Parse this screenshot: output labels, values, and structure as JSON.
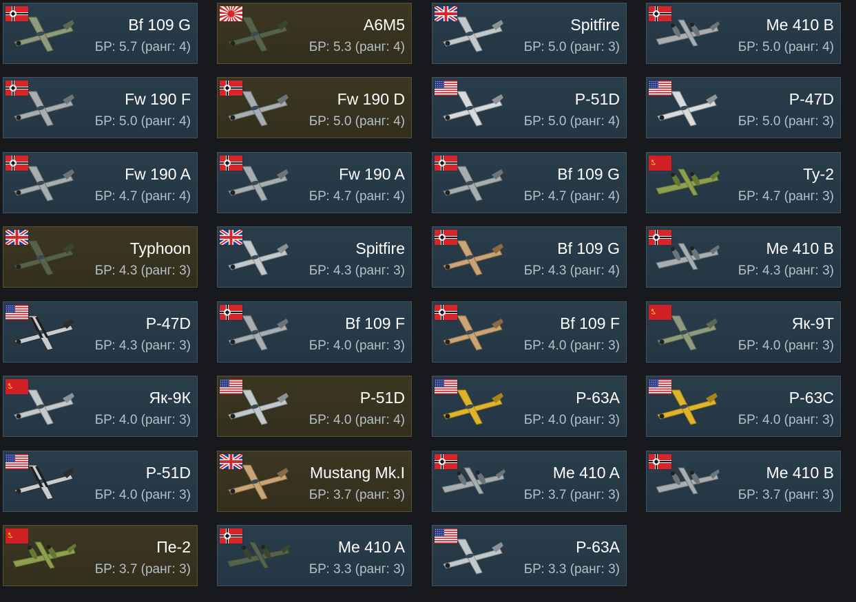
{
  "br_prefix": "БР:",
  "rank_word": "ранг",
  "colors": {
    "card_bg": "#263947",
    "card_border": "#3f5564",
    "premium_bg": "#363220",
    "premium_border": "#5a5230",
    "title": "#ffffff",
    "subtitle": "#b4c0c8"
  },
  "vehicles": [
    {
      "nation": "germany",
      "name": "Bf 109 G",
      "br": "5.7",
      "rank": "4",
      "premium": false,
      "camo": "green",
      "plane": "fighter"
    },
    {
      "nation": "japan",
      "name": "A6M5",
      "br": "5.3",
      "rank": "4",
      "premium": true,
      "camo": "darkgreen",
      "plane": "fighter"
    },
    {
      "nation": "britain",
      "name": "Spitfire",
      "br": "5.0",
      "rank": "3",
      "premium": false,
      "camo": "silver",
      "plane": "fighter"
    },
    {
      "nation": "germany",
      "name": "Me 410 B",
      "br": "5.0",
      "rank": "4",
      "premium": false,
      "camo": "gray",
      "plane": "twin"
    },
    {
      "nation": "germany",
      "name": "Fw 190 F",
      "br": "5.0",
      "rank": "4",
      "premium": false,
      "camo": "gray",
      "plane": "fighter"
    },
    {
      "nation": "germany",
      "name": "Fw 190 D",
      "br": "5.0",
      "rank": "4",
      "premium": true,
      "camo": "gray",
      "plane": "fighter"
    },
    {
      "nation": "usa",
      "name": "P-51D",
      "br": "5.0",
      "rank": "4",
      "premium": false,
      "camo": "white",
      "plane": "fighter"
    },
    {
      "nation": "usa",
      "name": "P-47D",
      "br": "5.0",
      "rank": "3",
      "premium": false,
      "camo": "white",
      "plane": "fighter"
    },
    {
      "nation": "germany",
      "name": "Fw 190 A",
      "br": "4.7",
      "rank": "4",
      "premium": false,
      "camo": "gray",
      "plane": "fighter"
    },
    {
      "nation": "germany",
      "name": "Fw 190 A",
      "br": "4.7",
      "rank": "4",
      "premium": false,
      "camo": "gray",
      "plane": "fighter"
    },
    {
      "nation": "germany",
      "name": "Bf 109 G",
      "br": "4.7",
      "rank": "4",
      "premium": false,
      "camo": "gray",
      "plane": "fighter"
    },
    {
      "nation": "ussr",
      "name": "Ту-2",
      "br": "4.7",
      "rank": "3",
      "premium": false,
      "camo": "olive",
      "plane": "twin"
    },
    {
      "nation": "britain",
      "name": "Typhoon",
      "br": "4.3",
      "rank": "3",
      "premium": true,
      "camo": "darkgreen",
      "plane": "fighter"
    },
    {
      "nation": "britain",
      "name": "Spitfire",
      "br": "4.3",
      "rank": "3",
      "premium": false,
      "camo": "silver",
      "plane": "fighter"
    },
    {
      "nation": "germany",
      "name": "Bf 109 G",
      "br": "4.3",
      "rank": "4",
      "premium": false,
      "camo": "desert",
      "plane": "fighter"
    },
    {
      "nation": "germany",
      "name": "Me 410 B",
      "br": "4.3",
      "rank": "3",
      "premium": false,
      "camo": "gray",
      "plane": "twin"
    },
    {
      "nation": "usa",
      "name": "P-47D",
      "br": "4.3",
      "rank": "3",
      "premium": false,
      "camo": "stripes",
      "plane": "fighter"
    },
    {
      "nation": "germany",
      "name": "Bf 109 F",
      "br": "4.0",
      "rank": "3",
      "premium": false,
      "camo": "gray",
      "plane": "fighter"
    },
    {
      "nation": "germany",
      "name": "Bf 109 F",
      "br": "4.0",
      "rank": "3",
      "premium": false,
      "camo": "desert",
      "plane": "fighter"
    },
    {
      "nation": "ussr",
      "name": "Як-9Т",
      "br": "4.0",
      "rank": "3",
      "premium": false,
      "camo": "green",
      "plane": "fighter"
    },
    {
      "nation": "ussr",
      "name": "Як-9К",
      "br": "4.0",
      "rank": "3",
      "premium": false,
      "camo": "silver",
      "plane": "fighter"
    },
    {
      "nation": "usa",
      "name": "P-51D",
      "br": "4.0",
      "rank": "4",
      "premium": true,
      "camo": "silver",
      "plane": "fighter"
    },
    {
      "nation": "usa",
      "name": "P-63A",
      "br": "4.0",
      "rank": "3",
      "premium": false,
      "camo": "yellow",
      "plane": "fighter"
    },
    {
      "nation": "usa",
      "name": "P-63C",
      "br": "4.0",
      "rank": "3",
      "premium": false,
      "camo": "yellow",
      "plane": "fighter"
    },
    {
      "nation": "usa",
      "name": "P-51D",
      "br": "4.0",
      "rank": "3",
      "premium": false,
      "camo": "stripes",
      "plane": "fighter"
    },
    {
      "nation": "britain",
      "name": "Mustang Mk.I",
      "br": "3.7",
      "rank": "3",
      "premium": true,
      "camo": "desert",
      "plane": "fighter"
    },
    {
      "nation": "germany",
      "name": "Me 410 A",
      "br": "3.7",
      "rank": "3",
      "premium": false,
      "camo": "gray",
      "plane": "twin"
    },
    {
      "nation": "germany",
      "name": "Me 410 B",
      "br": "3.7",
      "rank": "3",
      "premium": false,
      "camo": "gray",
      "plane": "twin"
    },
    {
      "nation": "ussr",
      "name": "Пе-2",
      "br": "3.7",
      "rank": "3",
      "premium": true,
      "camo": "olive",
      "plane": "twin"
    },
    {
      "nation": "germany",
      "name": "Me 410 A",
      "br": "3.3",
      "rank": "3",
      "premium": false,
      "camo": "darkgreen",
      "plane": "twin"
    },
    {
      "nation": "usa",
      "name": "P-63A",
      "br": "3.3",
      "rank": "3",
      "premium": false,
      "camo": "silver",
      "plane": "fighter"
    }
  ]
}
